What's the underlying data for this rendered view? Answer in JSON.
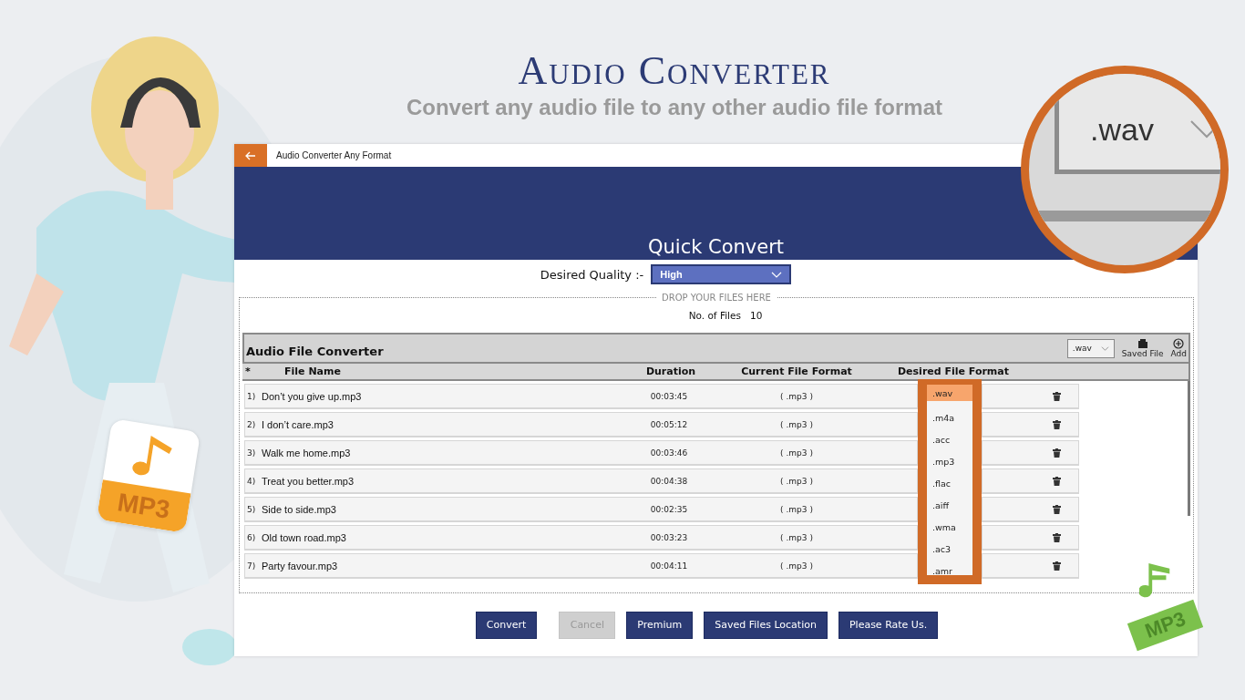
{
  "promo": {
    "title": "Audio Converter",
    "subtitle": "Convert any audio file to any other audio file format"
  },
  "badges": [
    {
      "label": "MP3",
      "color": "#f5a328"
    },
    {
      "label": "MP3",
      "color": "#7cc14c"
    }
  ],
  "window": {
    "title": "Audio Converter Any Format"
  },
  "banner": {
    "title": "Quick Convert"
  },
  "quality": {
    "label": "Desired Quality :-",
    "value": "High"
  },
  "drop_zone": {
    "label": "DROP YOUR FILES HERE",
    "count_label": "No. of Files",
    "count": "10"
  },
  "table": {
    "title": "Audio File Converter",
    "format": ".wav",
    "tools": [
      {
        "kind": "folder",
        "label": "Saved File"
      },
      {
        "kind": "add",
        "label": "Add"
      }
    ],
    "columns": [
      "*",
      "File Name",
      "Duration",
      "Current File Format",
      "Desired File Format"
    ],
    "rows": [
      {
        "index": "1)",
        "name": "Don’t you give up.mp3",
        "duration": "00:03:45",
        "format": "( .mp3 )"
      },
      {
        "index": "2)",
        "name": "I don’t care.mp3",
        "duration": "00:05:12",
        "format": "( .mp3 )"
      },
      {
        "index": "3)",
        "name": "Walk me home.mp3",
        "duration": "00:03:46",
        "format": "( .mp3 )"
      },
      {
        "index": "4)",
        "name": "Treat you better.mp3",
        "duration": "00:04:38",
        "format": "( .mp3 )"
      },
      {
        "index": "5)",
        "name": "Side to side.mp3",
        "duration": "00:02:35",
        "format": "( .mp3 )"
      },
      {
        "index": "6)",
        "name": "Old town road.mp3",
        "duration": "00:03:23",
        "format": "( .mp3 )"
      },
      {
        "index": "7)",
        "name": "Party favour.mp3",
        "duration": "00:04:11",
        "format": "( .mp3 )"
      }
    ]
  },
  "format_menu": {
    "items": [
      {
        "label": ".wav",
        "selected": true
      },
      {
        "label": ".m4a",
        "selected": false
      },
      {
        "label": ".acc",
        "selected": false
      },
      {
        "label": ".mp3",
        "selected": false
      },
      {
        "label": ".flac",
        "selected": false
      },
      {
        "label": ".aiff",
        "selected": false
      },
      {
        "label": ".wma",
        "selected": false
      },
      {
        "label": ".ac3",
        "selected": false
      },
      {
        "label": ".amr",
        "selected": false
      }
    ]
  },
  "buttons": [
    {
      "label": "Convert",
      "disabled": false
    },
    {
      "label": "Cancel",
      "disabled": true
    },
    {
      "label": "Premium",
      "disabled": false
    },
    {
      "label": "Saved Files Location",
      "disabled": false
    },
    {
      "label": "Please Rate Us.",
      "disabled": false
    }
  ],
  "magnifier": {
    "value": ".wav"
  }
}
